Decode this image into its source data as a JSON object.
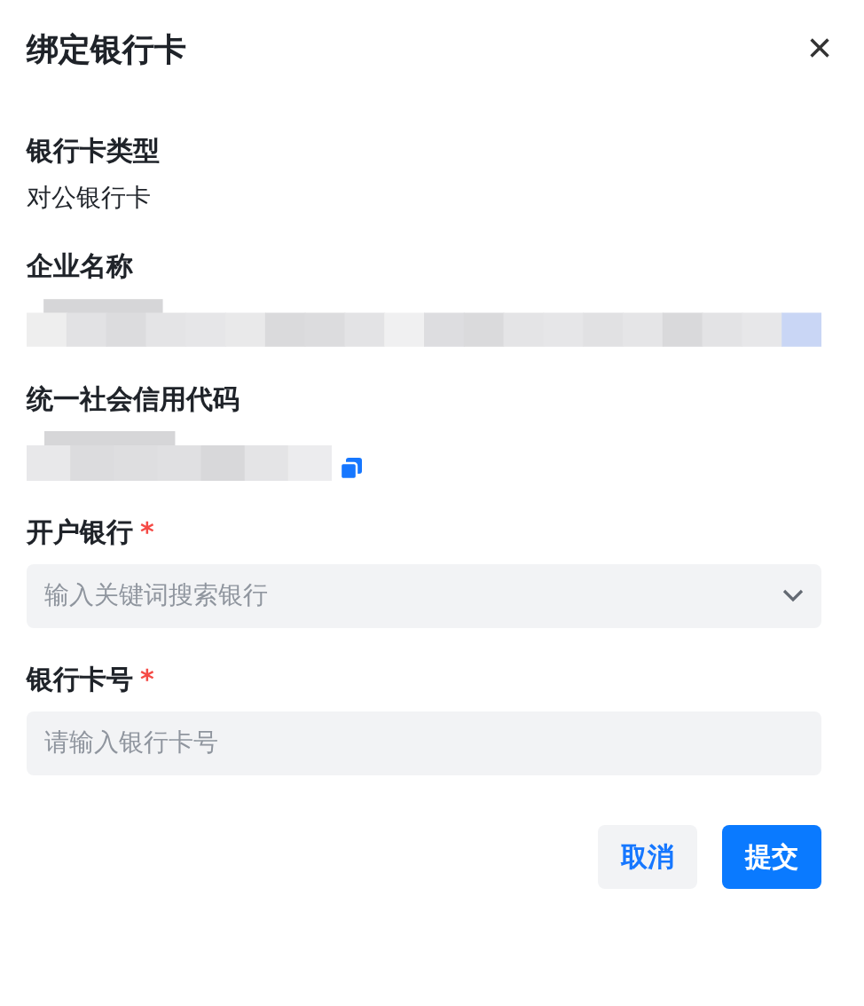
{
  "dialog": {
    "title": "绑定银行卡",
    "close": "×"
  },
  "fields": [
    {
      "kind": "info",
      "label": "银行卡类型",
      "value": "对公银行卡"
    },
    {
      "kind": "redacted",
      "label": "企业名称"
    },
    {
      "kind": "redacted_copy",
      "label": "统一社会信用代码"
    },
    {
      "kind": "select",
      "label": "开户银行",
      "required": true,
      "required_mark": "*",
      "placeholder": "输入关键词搜索银行"
    },
    {
      "kind": "input",
      "label": "银行卡号",
      "required": true,
      "required_mark": "*",
      "placeholder": "请输入银行卡号"
    }
  ],
  "buttons": [
    {
      "label": "取消",
      "kind": "secondary"
    },
    {
      "label": "提交",
      "kind": "primary"
    }
  ]
}
